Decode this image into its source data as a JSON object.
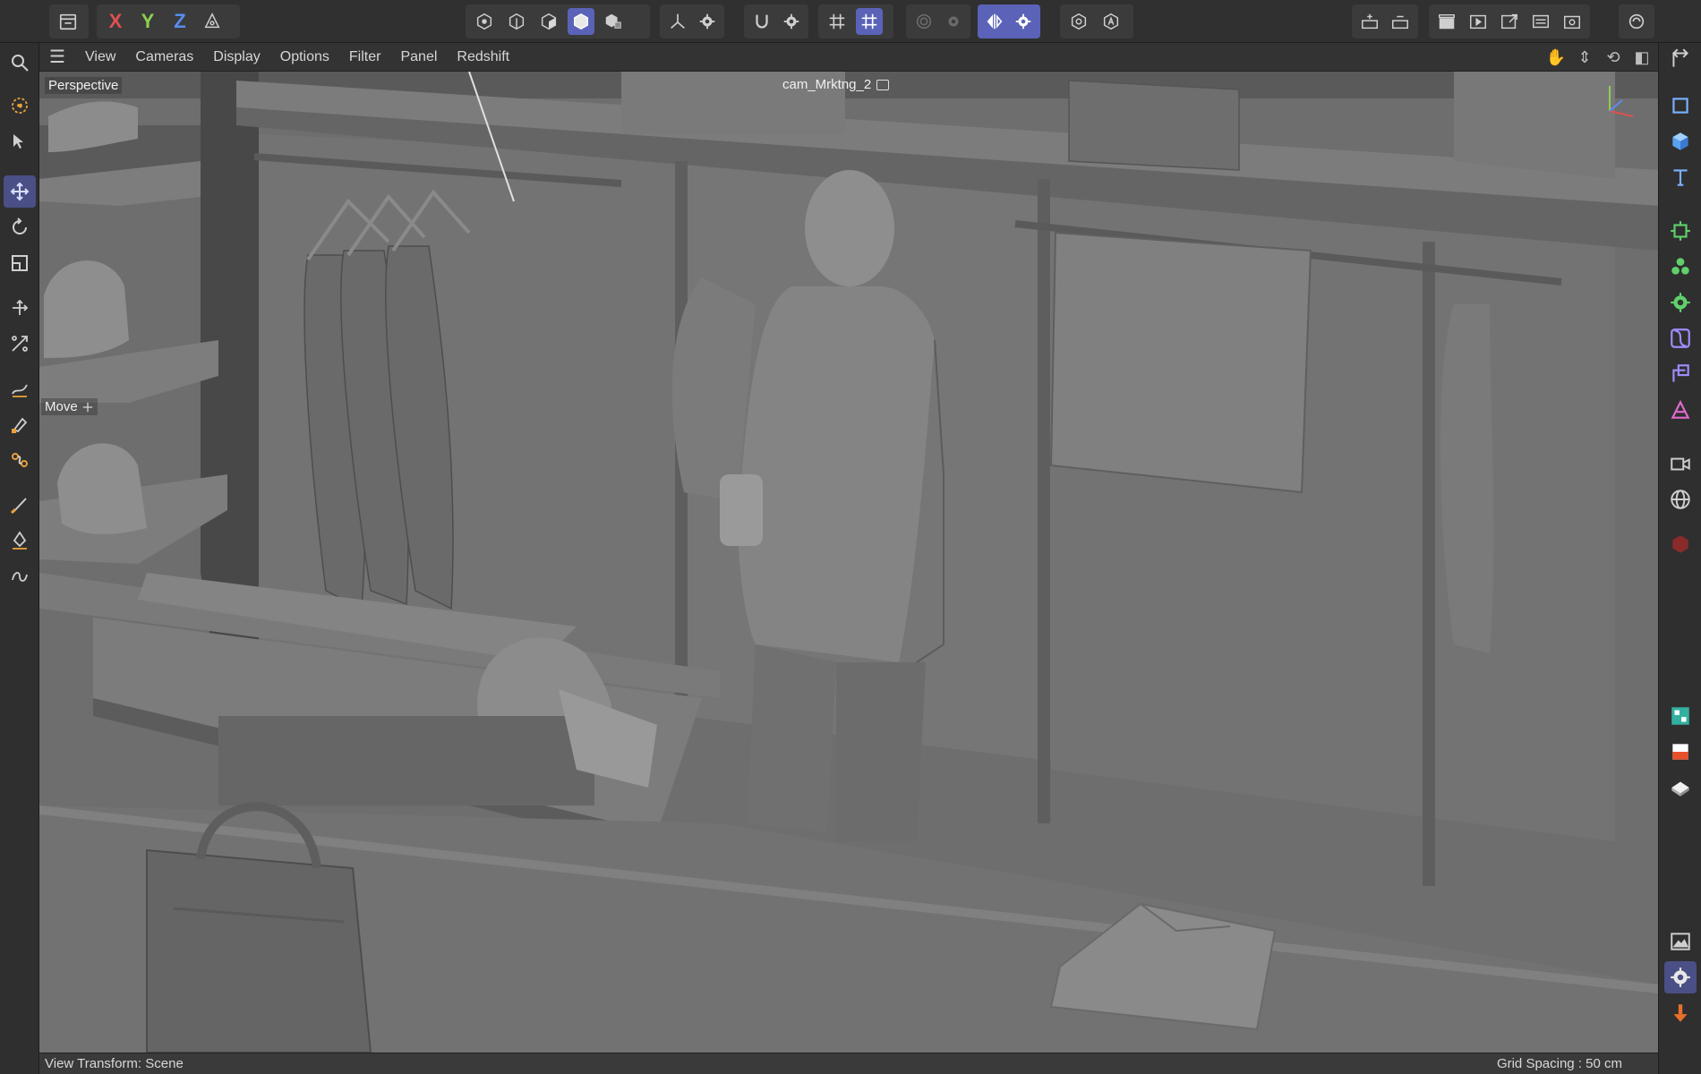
{
  "toolbar": {
    "axis_x": "X",
    "axis_y": "Y",
    "axis_z": "Z"
  },
  "viewport_menu": {
    "items": [
      "View",
      "Cameras",
      "Display",
      "Options",
      "Filter",
      "Panel",
      "Redshift"
    ]
  },
  "viewport": {
    "view_name": "Perspective",
    "camera_name": "cam_Mrktng_2",
    "active_tool": "Move"
  },
  "status": {
    "view_transform": "View Transform: Scene",
    "grid_spacing": "Grid Spacing : 50 cm"
  },
  "colors": {
    "accent_active": "#5a63b8",
    "axis_x": "#e05050",
    "axis_y": "#8cd050",
    "axis_z": "#5a8cf0",
    "viewport_bg": "#6d6d6d"
  }
}
